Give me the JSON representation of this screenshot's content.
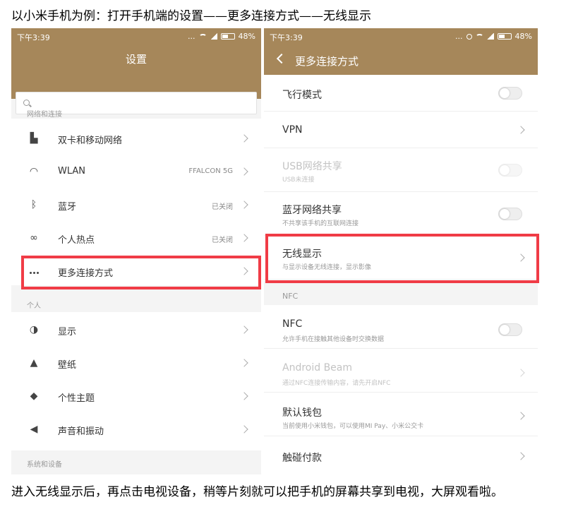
{
  "captions": {
    "top": "以小米手机为例：打开手机端的设置——更多连接方式——无线显示",
    "bottom": "进入无线显示后，再点击电视设备，稍等片刻就可以把手机的屏幕共享到电视，大屏观看啦。"
  },
  "status_bar": {
    "time": "下午3:39",
    "battery": "48%",
    "dots": "..."
  },
  "left_screen": {
    "title": "设置",
    "sections": {
      "network": "网络和连接",
      "personal": "个人",
      "system": "系统和设备"
    },
    "network_items": [
      {
        "icon": "sim-icon",
        "label": "双卡和移动网络",
        "value": ""
      },
      {
        "icon": "wifi-icon",
        "label": "WLAN",
        "value": "FFALCON 5G"
      },
      {
        "icon": "bluetooth-icon",
        "label": "蓝牙",
        "value": "已关闭"
      },
      {
        "icon": "hotspot-icon",
        "label": "个人热点",
        "value": "已关闭"
      },
      {
        "icon": "more-icon",
        "label": "更多连接方式",
        "value": ""
      }
    ],
    "personal_items": [
      {
        "icon": "display-icon",
        "label": "显示"
      },
      {
        "icon": "wallpaper-icon",
        "label": "壁纸"
      },
      {
        "icon": "theme-icon",
        "label": "个性主题"
      },
      {
        "icon": "speaker-icon",
        "label": "声音和振动"
      }
    ]
  },
  "right_screen": {
    "title": "更多连接方式",
    "items": {
      "airplane": {
        "label": "飞行模式"
      },
      "vpn": {
        "label": "VPN"
      },
      "usb": {
        "label": "USB网络共享",
        "sub": "USB未连接"
      },
      "bt_share": {
        "label": "蓝牙网络共享",
        "sub": "不共享该手机的互联网连接"
      },
      "wireless_display": {
        "label": "无线显示",
        "sub": "与显示设备无线连接，显示影像"
      },
      "nfc_section": "NFC",
      "nfc": {
        "label": "NFC",
        "sub": "允许手机在接触其他设备时交换数据"
      },
      "android_beam": {
        "label": "Android Beam",
        "sub": "通过NFC连接传输内容，请先开启NFC"
      },
      "wallet": {
        "label": "默认钱包",
        "sub": "当前使用小米钱包，可以使用MI Pay、小米公交卡"
      },
      "tap_pay": {
        "label": "触碰付款"
      }
    }
  },
  "colors": {
    "header": "#a6875a",
    "highlight": "#f03c46"
  }
}
